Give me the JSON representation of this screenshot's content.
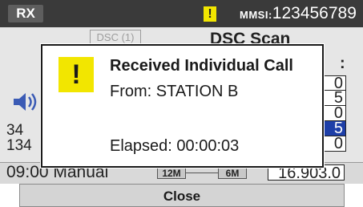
{
  "status_bar": {
    "mode_badge": "RX",
    "warning_mark": "!",
    "mmsi_label": "MMSI:",
    "mmsi_value": "123456789"
  },
  "scan_screen": {
    "dsc_tag": "DSC (1)",
    "title": "DSC Scan",
    "colon": ":",
    "channel_list": [
      {
        "text": "0",
        "selected": false
      },
      {
        "text": "5",
        "selected": false
      },
      {
        "text": "0",
        "selected": false
      },
      {
        "text": "5",
        "selected": true
      },
      {
        "text": "0",
        "selected": false
      }
    ],
    "left_lines": [
      "34",
      "134"
    ],
    "bottom_time_mode": "09:00 Manual",
    "toggle_left": "12M",
    "toggle_right": "6M",
    "frequency": "16.903.0"
  },
  "dialog": {
    "icon": "!",
    "title": "Received Individual Call",
    "from": "From: STATION B",
    "elapsed": "Elapsed: 00:00:03"
  },
  "footer": {
    "close_label": "Close"
  },
  "icons": {
    "speaker": "speaker-icon",
    "alert": "alert-icon"
  },
  "colors": {
    "alert_yellow": "#f2e600",
    "status_bar": "#3a3a3a",
    "selected_row": "#1e3fa8"
  }
}
